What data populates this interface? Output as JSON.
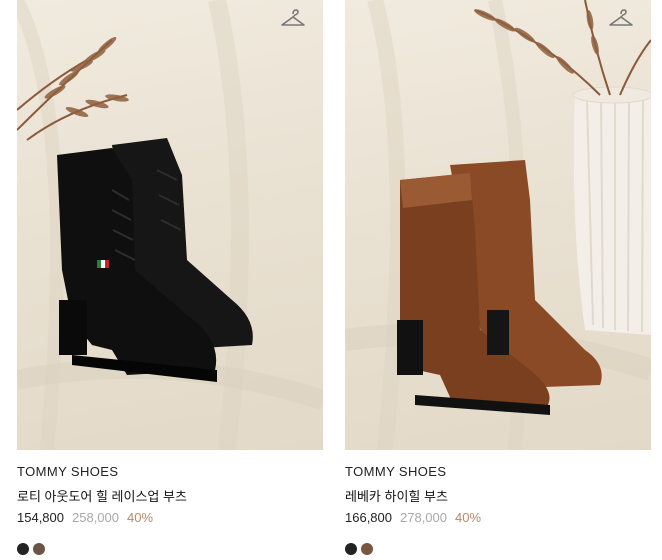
{
  "products": [
    {
      "brand": "TOMMY SHOES",
      "name": "로티 아웃도어 힐 레이스업 부츠",
      "price_sale": "154,800",
      "price_original": "258,000",
      "discount": "40%",
      "image_icon": "black-lace-up-boot-image",
      "swatch_colors": [
        "#222222",
        "#6b5446"
      ]
    },
    {
      "brand": "TOMMY SHOES",
      "name": "레베카 하이힐 부츠",
      "price_sale": "166,800",
      "price_original": "278,000",
      "discount": "40%",
      "image_icon": "brown-heel-boot-image",
      "swatch_colors": [
        "#222222",
        "#7a5540"
      ]
    }
  ],
  "icons": {
    "wishlist": "hanger-icon"
  },
  "colors": {
    "discount": "#b48a6a",
    "original_price": "#a8a8a8"
  }
}
